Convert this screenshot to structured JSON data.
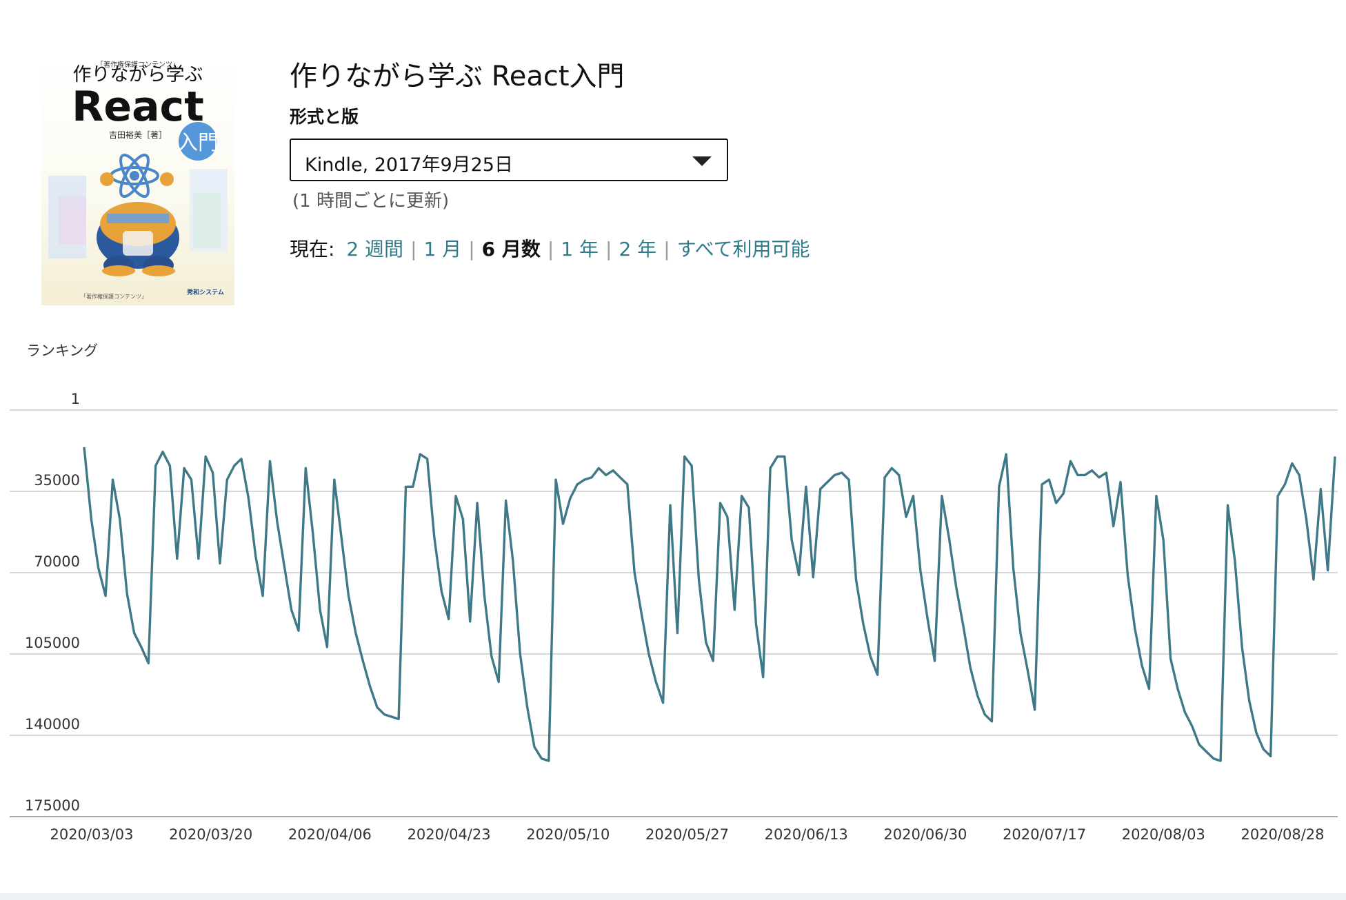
{
  "product": {
    "title": "作りながら学ぶ React入門",
    "cover_alt": "作りながら学ぶ React入門 cover",
    "cover": {
      "series_note": "「著作権保護コンテンツ」",
      "title_line1": "作りながら学ぶ",
      "title_line2": "React",
      "badge": "入門",
      "author": "吉田裕美［著］",
      "footer_note": "「著作権保護コンテンツ」",
      "publisher": "秀和システム"
    }
  },
  "format": {
    "label": "形式と版",
    "selected": "Kindle, 2017年9月25日",
    "update_note": "(1 時間ごとに更新)"
  },
  "range": {
    "prefix": "現在:",
    "options": [
      "2 週間",
      "1 月",
      "6 月数",
      "1 年",
      "2 年",
      "すべて利用可能"
    ],
    "current_index": 2
  },
  "colors": {
    "line": "#3f7887",
    "grid": "#cccccc",
    "link": "#2f7b8c"
  },
  "chart_data": {
    "type": "line",
    "ylabel": "ランキング",
    "y_inverted": true,
    "ylim": [
      1,
      175000
    ],
    "yticks": [
      1,
      35000,
      70000,
      105000,
      140000,
      175000
    ],
    "xticks": [
      "2020/03/03",
      "2020/03/20",
      "2020/04/06",
      "2020/04/23",
      "2020/05/10",
      "2020/05/27",
      "2020/06/13",
      "2020/06/30",
      "2020/07/17",
      "2020/08/03",
      "2020/08/28"
    ],
    "grid": true,
    "series": [
      {
        "values": [
          16000,
          47000,
          68000,
          80000,
          30000,
          47000,
          79000,
          96000,
          102000,
          109000,
          24000,
          18000,
          24000,
          64000,
          25000,
          30000,
          64000,
          20000,
          27000,
          66000,
          30000,
          24000,
          21000,
          38000,
          63000,
          80000,
          22000,
          48000,
          67000,
          86000,
          95000,
          25000,
          53000,
          86000,
          102000,
          30000,
          55000,
          80000,
          96000,
          108000,
          119000,
          128000,
          131000,
          132000,
          133000,
          33000,
          33000,
          19000,
          21000,
          55000,
          78000,
          90000,
          37000,
          47000,
          91000,
          40000,
          80000,
          106000,
          117000,
          39000,
          65000,
          105000,
          128000,
          145000,
          150000,
          151000,
          30000,
          49000,
          38000,
          32000,
          30000,
          29000,
          25000,
          28000,
          26000,
          29000,
          32000,
          70000,
          88000,
          105000,
          117000,
          126000,
          41000,
          96000,
          20000,
          24000,
          73000,
          100000,
          108000,
          40000,
          46000,
          86000,
          37000,
          42000,
          92000,
          115000,
          25000,
          20000,
          20000,
          56000,
          71000,
          33000,
          72000,
          34000,
          31000,
          28000,
          27000,
          30000,
          73000,
          92000,
          106000,
          114000,
          29000,
          25000,
          28000,
          46000,
          37000,
          69000,
          90000,
          108000,
          37000,
          55000,
          76000,
          93000,
          111000,
          123000,
          131000,
          134000,
          33000,
          19000,
          68000,
          96000,
          112000,
          129000,
          32000,
          30000,
          40000,
          36000,
          22000,
          28000,
          28000,
          26000,
          29000,
          27000,
          50000,
          31000,
          71000,
          94000,
          110000,
          120000,
          37000,
          56000,
          107000,
          120000,
          130000,
          136000,
          144000,
          147000,
          150000,
          151000,
          41000,
          65000,
          102000,
          125000,
          139000,
          146000,
          149000,
          37000,
          32000,
          23000,
          28000,
          47000,
          73000,
          34000,
          69000,
          20000
        ]
      }
    ]
  }
}
